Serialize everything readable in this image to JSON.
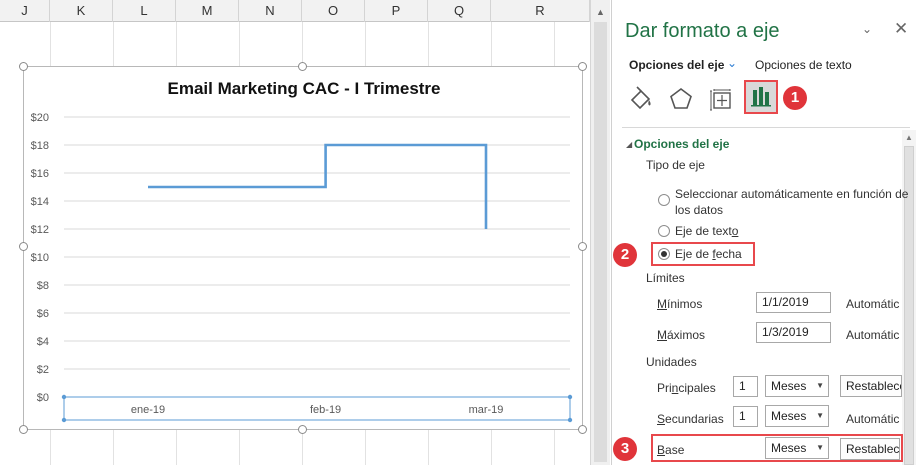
{
  "sheet": {
    "columns": [
      "J",
      "K",
      "L",
      "M",
      "N",
      "O",
      "P",
      "Q",
      "R"
    ]
  },
  "chart": {
    "title": "Email Marketing CAC - I Trimestre"
  },
  "chart_data": {
    "type": "line",
    "title": "Email Marketing CAC - I Trimestre",
    "xlabel": "",
    "ylabel": "",
    "y_ticks": [
      "$0",
      "$2",
      "$4",
      "$6",
      "$8",
      "$10",
      "$12",
      "$14",
      "$16",
      "$18",
      "$20"
    ],
    "ylim": [
      0,
      20
    ],
    "x_ticks": [
      "ene-19",
      "feb-19",
      "mar-19"
    ],
    "line_style": "step",
    "series": [
      {
        "points": [
          {
            "x": "2019-01-01",
            "y": 15
          },
          {
            "x": "2019-02-01",
            "y": 15
          },
          {
            "x": "2019-02-01",
            "y": 18
          },
          {
            "x": "2019-03-01",
            "y": 18
          },
          {
            "x": "2019-03-01",
            "y": 12
          }
        ],
        "color": "#5b9bd5"
      }
    ],
    "grid": true
  },
  "pane": {
    "title": "Dar formato a eje",
    "options_axis": "Opciones del eje",
    "options_text": "Opciones de texto",
    "section": "Opciones del eje",
    "axis_type_label": "Tipo de eje",
    "radio_auto_1": "Seleccionar automáticamente en función de",
    "radio_auto_2": "los datos",
    "radio_text_pre": "Eje de text",
    "radio_text_u": "o",
    "radio_date_pre": "Eje de ",
    "radio_date_u": "f",
    "radio_date_post": "echa",
    "limits_label": "Límites",
    "min_u": "M",
    "min_rest": "ínimos",
    "max_u": "M",
    "max_rest": "áximos",
    "min_value": "1/1/2019",
    "max_value": "1/3/2019",
    "min_status": "Automátic",
    "max_status": "Automátic",
    "units_label": "Unidades",
    "major_pre": "Pri",
    "major_u": "n",
    "major_post": "cipales",
    "minor_pre": "",
    "minor_u": "S",
    "minor_post": "ecundarias",
    "major_value": "1",
    "minor_value": "1",
    "major_select": "Meses",
    "minor_select": "Meses",
    "major_reset": "Restablece",
    "minor_status": "Automátic",
    "base_u": "B",
    "base_rest": "ase",
    "base_select": "Meses",
    "base_reset": "Restablece",
    "badges": [
      "1",
      "2",
      "3"
    ],
    "accent_color": "#217346",
    "highlight_color": "#e8484c"
  }
}
